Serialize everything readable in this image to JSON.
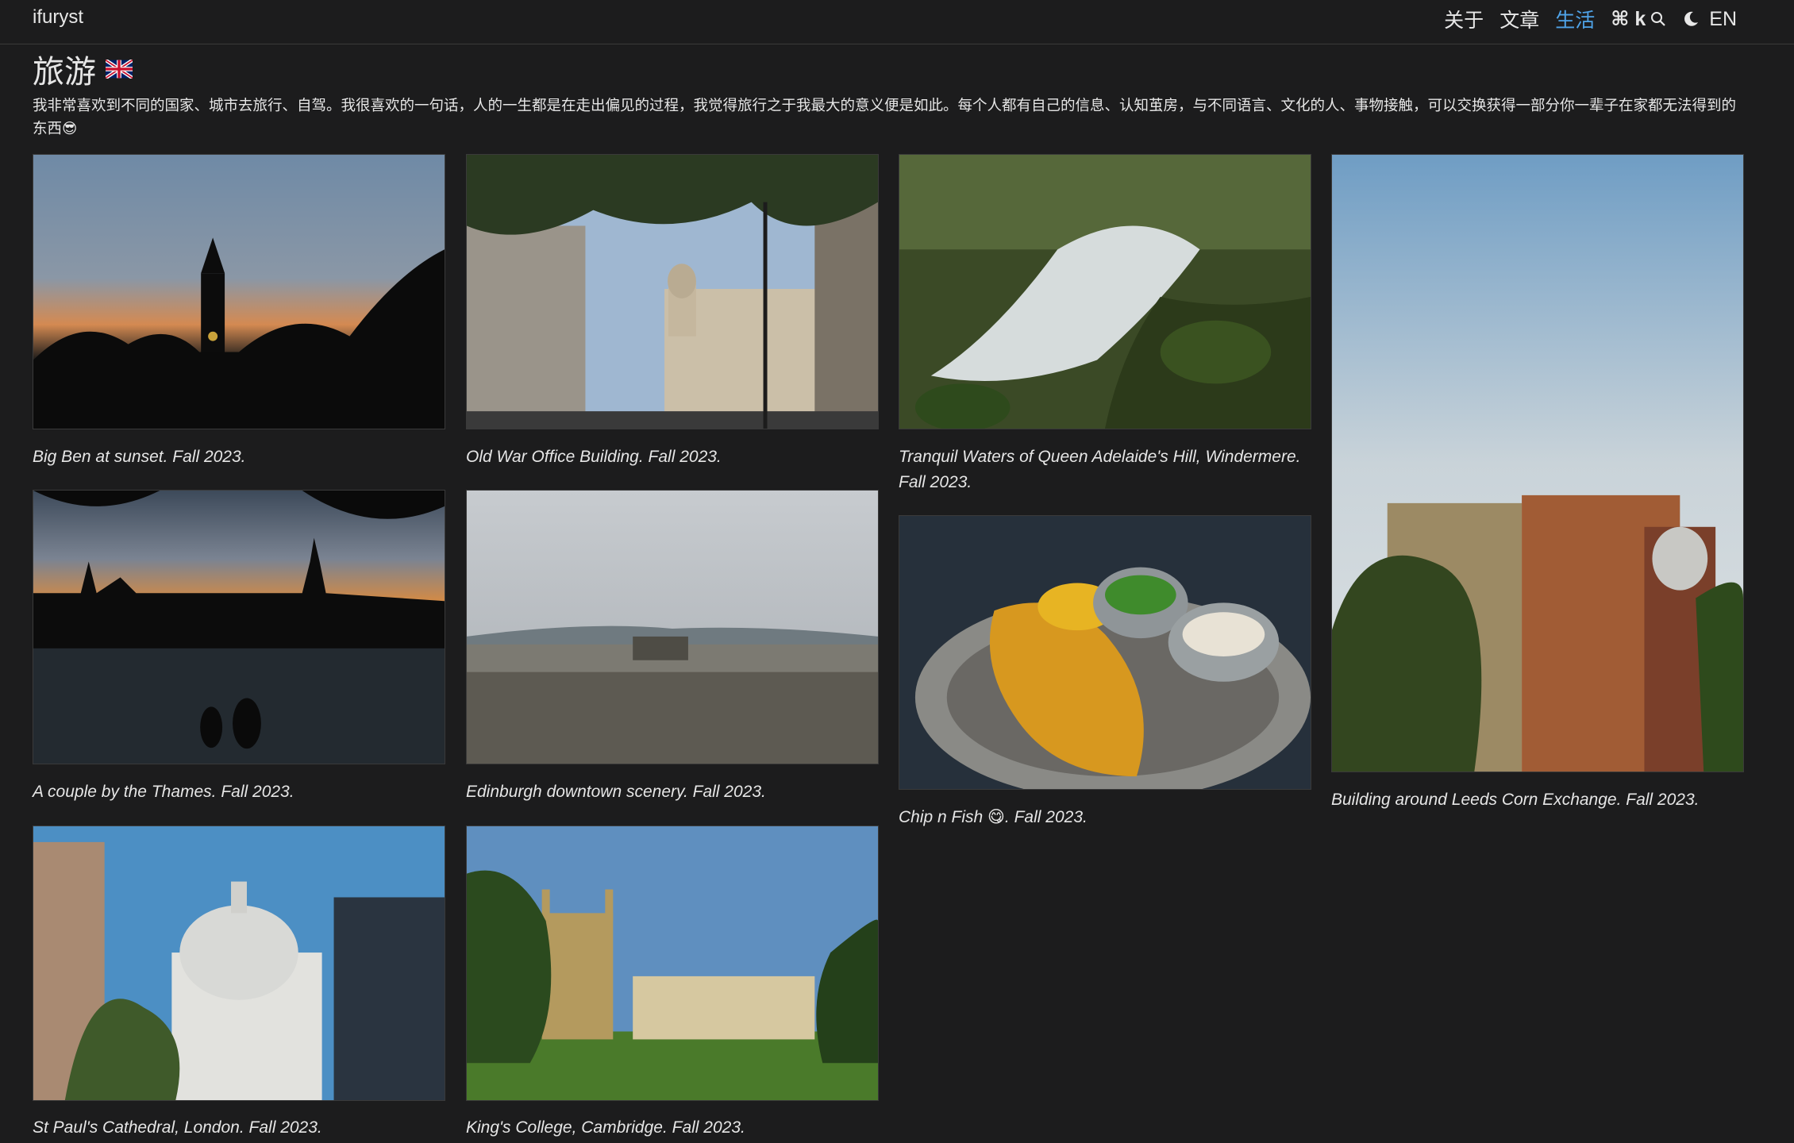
{
  "brand": "ifuryst",
  "nav": {
    "items": [
      "关于",
      "文章",
      "生活"
    ],
    "active_index": 2,
    "search_label": "⌘ k",
    "lang_label": "EN"
  },
  "page": {
    "title": "旅游",
    "intro": "我非常喜欢到不同的国家、城市去旅行、自驾。我很喜欢的一句话，人的一生都是在走出偏见的过程，我觉得旅行之于我最大的意义便是如此。每个人都有自己的信息、认知茧房，与不同语言、文化的人、事物接触，可以交换获得一部分你一辈子在家都无法得到的东西😎"
  },
  "gallery": [
    {
      "caption": "Big Ben at sunset. Fall 2023."
    },
    {
      "caption": "Old War Office Building. Fall 2023."
    },
    {
      "caption": "Tranquil Waters of Queen Adelaide's Hill, Windermere. Fall 2023."
    },
    {
      "caption": "Building around Leeds Corn Exchange. Fall 2023."
    },
    {
      "caption": "A couple by the Thames. Fall 2023."
    },
    {
      "caption": "Edinburgh downtown scenery. Fall 2023."
    },
    {
      "caption": "Chip n Fish 😋. Fall 2023."
    },
    {
      "caption": "St Paul's Cathedral, London. Fall 2023."
    },
    {
      "caption": "King's College, Cambridge. Fall 2023."
    }
  ],
  "colors": {
    "background": "#1c1c1d",
    "accent": "#4fa3e8",
    "text": "#e6e6e6"
  }
}
